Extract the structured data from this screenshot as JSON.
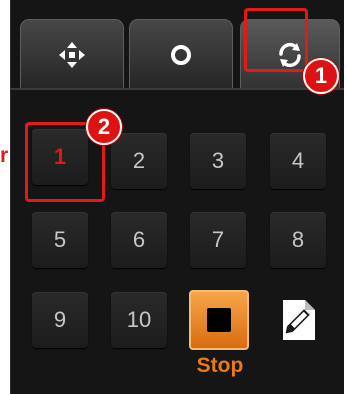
{
  "tabs": [
    {
      "icon": "move-arrows-icon"
    },
    {
      "icon": "record-circle-icon"
    },
    {
      "icon": "refresh-icon",
      "active": true
    }
  ],
  "presets": [
    {
      "label": "1",
      "active": true
    },
    {
      "label": "2"
    },
    {
      "label": "3"
    },
    {
      "label": "4"
    },
    {
      "label": "5"
    },
    {
      "label": "6"
    },
    {
      "label": "7"
    },
    {
      "label": "8"
    },
    {
      "label": "9"
    },
    {
      "label": "10"
    }
  ],
  "stop": {
    "label": "Stop",
    "icon": "stop-square-icon"
  },
  "edit": {
    "icon": "edit-document-icon"
  },
  "callouts": [
    {
      "number": "1"
    },
    {
      "number": "2"
    }
  ],
  "edge_text": "r",
  "colors": {
    "callout_red": "#e11a1a",
    "stop_orange": "#ea7a14",
    "active_red": "#e01717",
    "panel_bg": "#151515"
  }
}
